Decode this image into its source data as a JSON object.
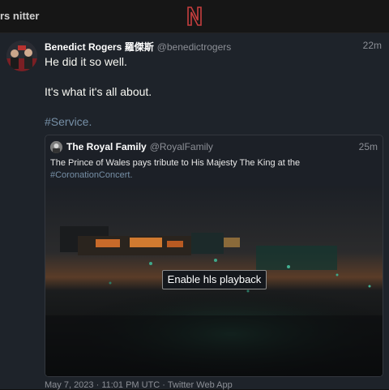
{
  "navbar": {
    "title": "rs nitter",
    "logo": "nitter-logo"
  },
  "tweet": {
    "fullname": "Benedict Rogers 羅傑斯",
    "username": "@benedictrogers",
    "date": "22m",
    "lines": [
      "He did it so well.",
      "It's what it's all about."
    ],
    "hashtag": "#Service.",
    "published": "May 7, 2023 · 11:01 PM UTC · Twitter Web App"
  },
  "quote": {
    "fullname": "The Royal Family",
    "username": "@RoyalFamily",
    "date": "25m",
    "text": "The Prince of Wales pays tribute to His Majesty The King at the",
    "hashtag": "#CoronationConcert.",
    "video_button": "Enable hls playback"
  },
  "colors": {
    "background": "#1e232a",
    "link": "#768fa6",
    "accent": "#c73e3e"
  }
}
